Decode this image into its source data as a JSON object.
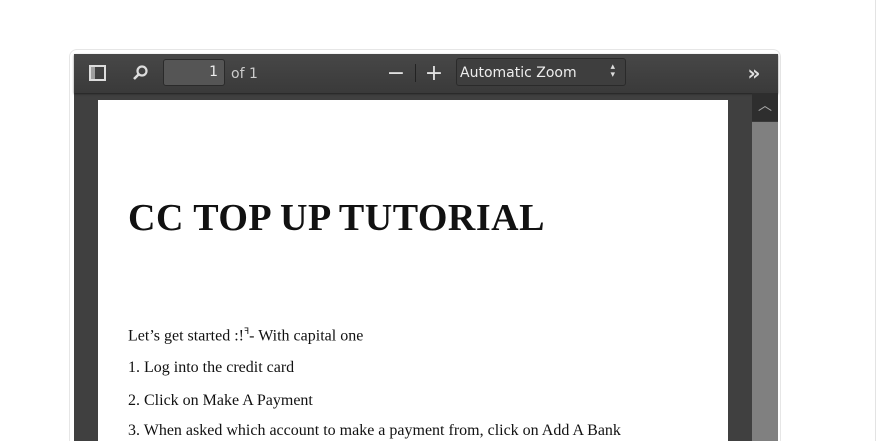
{
  "toolbar": {
    "page_number": "1",
    "page_count": "of 1",
    "zoom": "Automatic Zoom"
  },
  "document": {
    "title": "CC TOP UP TUTORIAL",
    "intro": "Let’s get started :!",
    "intro_tail": "- With capital one",
    "steps": [
      "1.  Log into the credit card",
      "2.  Click on Make A Payment",
      "3.  When asked which account to make a payment from, click on Add A Bank"
    ]
  }
}
